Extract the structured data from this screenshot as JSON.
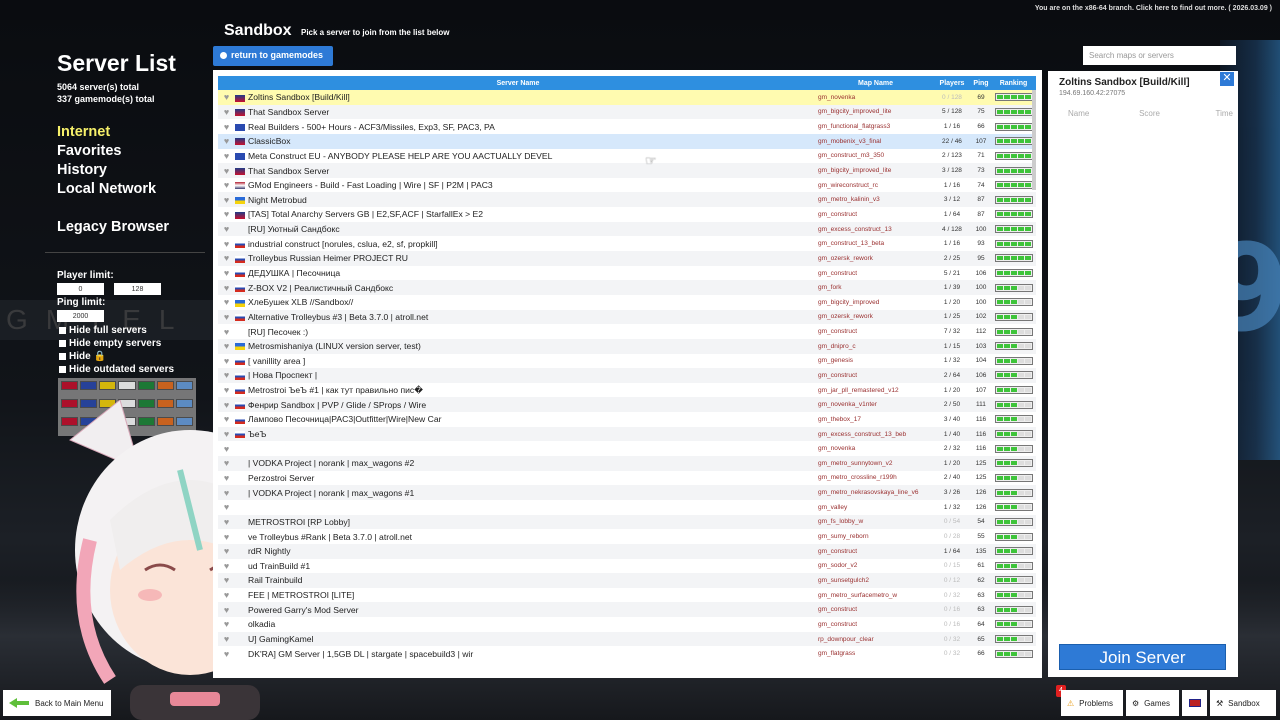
{
  "branch_note": "You are on the x86-64 branch. Click here to find out more. ( 2026.03.09 )",
  "sidebar": {
    "title": "Server List",
    "servers_total": "5064 server(s) total",
    "gamemodes_total": "337 gamemode(s) total",
    "nav": [
      "Internet",
      "Favorites",
      "History",
      "Local Network"
    ],
    "legacy": "Legacy Browser"
  },
  "filters": {
    "player_limit_label": "Player limit:",
    "player_min": "0",
    "player_max": "128",
    "ping_limit_label": "Ping limit:",
    "ping_value": "2000",
    "hide_full": "Hide full servers",
    "hide_empty": "Hide empty servers",
    "hide_locked": "Hide",
    "hide_outdated": "Hide outdated servers"
  },
  "header": {
    "title": "Sandbox",
    "subtitle": "Pick a server to join from the list below",
    "return_label": "return to gamemodes"
  },
  "table": {
    "columns": [
      "Server Name",
      "Map Name",
      "Players",
      "Ping",
      "Ranking"
    ],
    "rows": [
      {
        "name": "Zoltins Sandbox [Build/Kill]",
        "map": "gm_novenka",
        "players": "0 / 128",
        "ping": "69",
        "rank": 5,
        "flag": "uk",
        "hl": "yellow",
        "empty": true
      },
      {
        "name": "That Sandbox Server",
        "map": "gm_bigcity_improved_lite",
        "players": "5 / 128",
        "ping": "75",
        "rank": 5,
        "flag": "uk"
      },
      {
        "name": "Real Builders - 500+ Hours - ACF3/Missiles, Exp3, SF, PAC3, PA",
        "map": "gm_functional_flatgrass3",
        "players": "1 / 16",
        "ping": "66",
        "rank": 5,
        "flag": "eu"
      },
      {
        "name": "ClassicBox",
        "map": "gm_mobenix_v3_final",
        "players": "22 / 46",
        "ping": "107",
        "rank": 5,
        "flag": "uk",
        "hl": "blue"
      },
      {
        "name": "Meta Construct EU - ANYBODY PLEASE HELP ARE YOU AACTUALLY DEVEL",
        "map": "gm_construct_m3_350",
        "players": "2 / 123",
        "ping": "71",
        "rank": 5,
        "flag": "eu"
      },
      {
        "name": "That Sandbox Server",
        "map": "gm_bigcity_improved_lite",
        "players": "3 / 128",
        "ping": "73",
        "rank": 5,
        "flag": "uk"
      },
      {
        "name": "GMod Engineers - Build - Fast Loading | Wire | SF | P2M | PAC3",
        "map": "gm_wireconstruct_rc",
        "players": "1 / 16",
        "ping": "74",
        "rank": 5,
        "flag": "us"
      },
      {
        "name": "Night Metrobud",
        "map": "gm_metro_kalinin_v3",
        "players": "3 / 12",
        "ping": "87",
        "rank": 5,
        "flag": "ua"
      },
      {
        "name": "[TAS] Total Anarchy Servers GB | E2,SF,ACF | StarfallEx > E2",
        "map": "gm_construct",
        "players": "1 / 64",
        "ping": "87",
        "rank": 5,
        "flag": "uk"
      },
      {
        "name": "[RU] Уютный Сандбокс",
        "map": "gm_excess_construct_13",
        "players": "4 / 128",
        "ping": "100",
        "rank": 5,
        "flag": ""
      },
      {
        "name": "industrial construct [norules, cslua, e2, sf, propkill]",
        "map": "gm_construct_13_beta",
        "players": "1 / 16",
        "ping": "93",
        "rank": 5,
        "flag": "ru"
      },
      {
        "name": "Trolleybus Russian Heimer PROJECT RU",
        "map": "gm_ozersk_rework",
        "players": "2 / 25",
        "ping": "95",
        "rank": 5,
        "flag": "ru"
      },
      {
        "name": "ДЕДУШКА | Песочница",
        "map": "gm_construct",
        "players": "5 / 21",
        "ping": "106",
        "rank": 5,
        "flag": "ru"
      },
      {
        "name": "Z-BOX V2 | Реалистичный Сандбокс",
        "map": "gm_fork",
        "players": "1 / 39",
        "ping": "100",
        "rank": 3,
        "flag": "ru"
      },
      {
        "name": "ХлеБушек XLB //Sandbox//",
        "map": "gm_bigcity_improved",
        "players": "1 / 20",
        "ping": "100",
        "rank": 3,
        "flag": "ua"
      },
      {
        "name": "Alternative Trolleybus #3 | Beta 3.7.0 | atroll.net",
        "map": "gm_ozersk_rework",
        "players": "1 / 25",
        "ping": "102",
        "rank": 3,
        "flag": "ru"
      },
      {
        "name": "[RU] Песочек :)",
        "map": "gm_construct",
        "players": "7 / 32",
        "ping": "112",
        "rank": 3,
        "flag": ""
      },
      {
        "name": "Metrosmishaniya (LINUX version server, test)",
        "map": "gm_dnipro_c",
        "players": "1 / 15",
        "ping": "103",
        "rank": 3,
        "flag": "ua"
      },
      {
        "name": "[ vanillity area ]",
        "map": "gm_genesis",
        "players": "1 / 32",
        "ping": "104",
        "rank": 3,
        "flag": "ru"
      },
      {
        "name": "| Нова Проспект |",
        "map": "gm_construct",
        "players": "2 / 64",
        "ping": "106",
        "rank": 3,
        "flag": "ru"
      },
      {
        "name": "Metrostroi ЪеЪ #1 | как тут правильно пис�",
        "map": "gm_jar_pll_remastered_v12",
        "players": "1 / 20",
        "ping": "107",
        "rank": 3,
        "flag": "ru"
      },
      {
        "name": "Фенрир Sandbox | PVP / Glide / SProps / Wire",
        "map": "gm_novenka_v1nter",
        "players": "2 / 50",
        "ping": "111",
        "rank": 3,
        "flag": "ru"
      },
      {
        "name": "Лампово Песочница|PAC3|Outfitter|Wire|New Car",
        "map": "gm_thebox_17",
        "players": "3 / 40",
        "ping": "116",
        "rank": 3,
        "flag": "ru"
      },
      {
        "name": "ЪеЪ",
        "map": "gm_excess_construct_13_beb",
        "players": "1 / 40",
        "ping": "116",
        "rank": 3,
        "flag": "ru"
      },
      {
        "name": "",
        "map": "gm_novenka",
        "players": "2 / 32",
        "ping": "116",
        "rank": 3,
        "flag": ""
      },
      {
        "name": "| VODKA Project | norank | max_wagons #2",
        "map": "gm_metro_sunnytown_v2",
        "players": "1 / 20",
        "ping": "125",
        "rank": 3,
        "flag": ""
      },
      {
        "name": "Perzostroi Server",
        "map": "gm_metro_crossline_r199h",
        "players": "2 / 40",
        "ping": "125",
        "rank": 3,
        "flag": ""
      },
      {
        "name": "| VODKA Project | norank | max_wagons #1",
        "map": "gm_metro_nekrasovskaya_line_v6",
        "players": "3 / 26",
        "ping": "126",
        "rank": 3,
        "flag": ""
      },
      {
        "name": "",
        "map": "gm_valley",
        "players": "1 / 32",
        "ping": "126",
        "rank": 3,
        "flag": ""
      },
      {
        "name": "METROSTROI [RP Lobby]",
        "map": "gm_fs_lobby_w",
        "players": "0 / 54",
        "ping": "54",
        "rank": 3,
        "flag": "",
        "empty": true
      },
      {
        "name": "ve Trolleybus #Rank | Beta 3.7.0 | atroll.net",
        "map": "gm_sumy_reborn",
        "players": "0 / 28",
        "ping": "55",
        "rank": 3,
        "flag": "",
        "empty": true
      },
      {
        "name": "rdR Nightly",
        "map": "gm_construct",
        "players": "1 / 64",
        "ping": "135",
        "rank": 3,
        "flag": ""
      },
      {
        "name": "ud TrainBuild #1",
        "map": "gm_sodor_v2",
        "players": "0 / 15",
        "ping": "61",
        "rank": 3,
        "flag": "",
        "empty": true
      },
      {
        "name": "Rail Trainbuild",
        "map": "gm_sunsetgulch2",
        "players": "0 / 12",
        "ping": "62",
        "rank": 3,
        "flag": "",
        "empty": true
      },
      {
        "name": "FEE | METROSTROI [LITE]",
        "map": "gm_metro_surfacemetro_w",
        "players": "0 / 32",
        "ping": "63",
        "rank": 3,
        "flag": "",
        "empty": true
      },
      {
        "name": "Powered Garry's Mod Server",
        "map": "gm_construct",
        "players": "0 / 16",
        "ping": "63",
        "rank": 3,
        "flag": "",
        "empty": true
      },
      {
        "name": "olkadia",
        "map": "gm_construct",
        "players": "0 / 16",
        "ping": "64",
        "rank": 3,
        "flag": "",
        "empty": true
      },
      {
        "name": "U] GamingKamel",
        "map": "rp_downpour_clear",
        "players": "0 / 32",
        "ping": "65",
        "rank": 3,
        "flag": "",
        "empty": true
      },
      {
        "name": "DK'RA] GM Server | 1,5GB DL | stargate | spacebuild3 | wir",
        "map": "gm_flatgrass",
        "players": "0 / 32",
        "ping": "66",
        "rank": 3,
        "flag": "",
        "empty": true
      }
    ]
  },
  "search": {
    "placeholder": "Search maps or servers"
  },
  "info_panel": {
    "name": "Zoltins Sandbox [Build/Kill]",
    "ip": "194.69.160.42:27075",
    "columns": [
      "Name",
      "Score",
      "Time"
    ],
    "join_label": "Join Server"
  },
  "bottom": {
    "back_label": "Back to Main Menu",
    "problems_label": "Problems",
    "problems_count": "4",
    "games_label": "Games",
    "sandbox_label": "Sandbox"
  },
  "colors": {
    "accent": "#2e7ad6",
    "header": "#2e8fe0",
    "active_nav": "#f6f06a",
    "rank_green": "#3ec43a"
  }
}
